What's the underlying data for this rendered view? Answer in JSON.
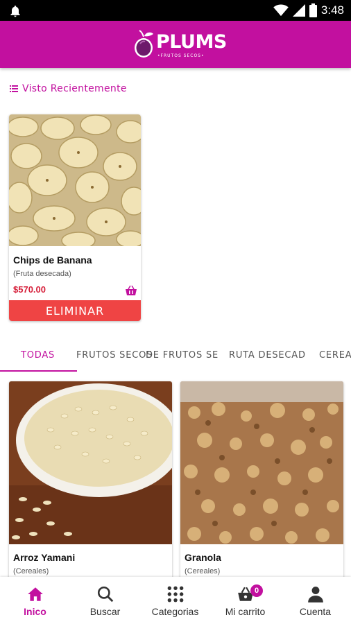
{
  "status_bar": {
    "time": "3:48",
    "icons": [
      "notification-bell-icon",
      "wifi-icon",
      "signal-icon",
      "battery-icon"
    ]
  },
  "app_bar": {
    "logo_text": "PLUMS",
    "logo_subtext": "•FRUTOS SECOS•",
    "color": "#c2109f"
  },
  "recent": {
    "title": "Visto Recientemente",
    "items": [
      {
        "name": "Chips de Banana",
        "category": "(Fruta desecada)",
        "price": "$570.00",
        "remove_label": "ELIMINAR"
      }
    ]
  },
  "tabs": [
    {
      "label": "TODAS",
      "active": true
    },
    {
      "label": "FRUTOS SECOS",
      "active": false
    },
    {
      "label": "DE FRUTOS SE",
      "active": false
    },
    {
      "label": "RUTA DESECAD",
      "active": false
    },
    {
      "label": "CEREA",
      "active": false
    }
  ],
  "products": [
    {
      "name": "Arroz Yamani",
      "category": "(Cereales)"
    },
    {
      "name": "Granola",
      "category": "(Cereales)"
    }
  ],
  "bottom_nav": [
    {
      "label": "Inico",
      "icon": "home-icon",
      "active": true
    },
    {
      "label": "Buscar",
      "icon": "search-icon",
      "active": false
    },
    {
      "label": "Categorias",
      "icon": "grid-icon",
      "active": false
    },
    {
      "label": "Mi carrito",
      "icon": "cart-icon",
      "active": false,
      "badge": "0"
    },
    {
      "label": "Cuenta",
      "icon": "account-icon",
      "active": false
    }
  ],
  "colors": {
    "accent": "#c2109f",
    "price": "#d61f3a",
    "remove": "#ef4444"
  }
}
